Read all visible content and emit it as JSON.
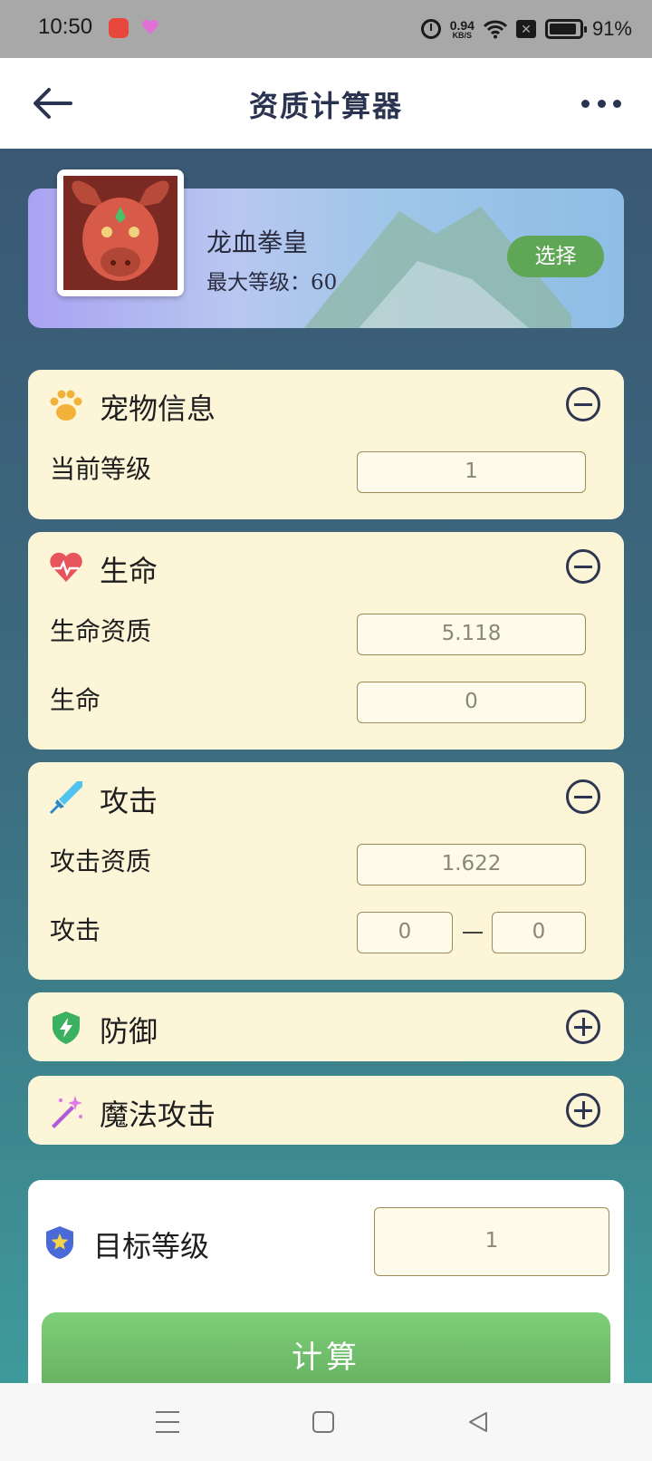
{
  "status_bar": {
    "time": "10:50",
    "net_speed_value": "0.94",
    "net_speed_unit": "KB/S",
    "sim_glyph": "✕",
    "battery_percent": "91%",
    "battery_level": 0.91,
    "icons": [
      "app-icon",
      "heart-app-icon",
      "alarm-icon",
      "wifi-icon",
      "sim-icon",
      "battery-icon"
    ]
  },
  "header": {
    "title": "资质计算器",
    "icons": [
      "back-arrow-icon",
      "more-icon"
    ]
  },
  "pet": {
    "name": "龙血拳皇",
    "max_level_label": "最大等级：60",
    "select_label": "选择"
  },
  "sections": {
    "pet_info": {
      "title": "宠物信息",
      "icon": "paw-icon",
      "expanded": true,
      "current_level_label": "当前等级",
      "current_level_value": "1"
    },
    "health": {
      "title": "生命",
      "icon": "heart-icon",
      "expanded": true,
      "aptitude_label": "生命资质",
      "aptitude_value": "5.118",
      "stat_label": "生命",
      "stat_value": "0"
    },
    "attack": {
      "title": "攻击",
      "icon": "sword-icon",
      "expanded": true,
      "aptitude_label": "攻击资质",
      "aptitude_value": "1.622",
      "stat_label": "攻击",
      "stat_min": "0",
      "stat_max": "0"
    },
    "defense": {
      "title": "防御",
      "icon": "shield-icon",
      "expanded": false
    },
    "magic_attack": {
      "title": "魔法攻击",
      "icon": "magic-wand-icon",
      "expanded": false
    }
  },
  "target": {
    "label": "目标等级",
    "icon": "star-badge-icon",
    "value": "1",
    "calculate_label": "计算"
  },
  "colors": {
    "card_bg": "#fdf5d8",
    "primary_green": "#5fa657",
    "title_navy": "#2a3350",
    "background_top": "#3a5874",
    "background_bottom": "#3e9a9a"
  }
}
